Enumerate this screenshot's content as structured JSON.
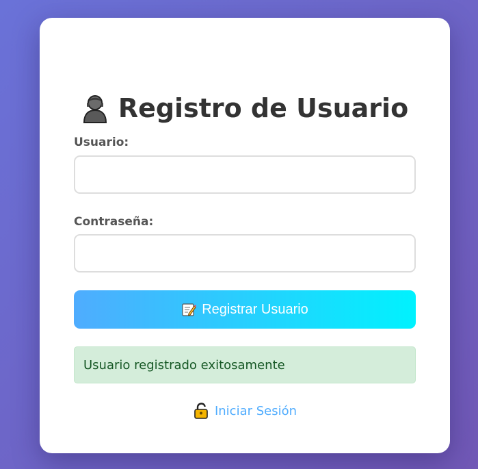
{
  "form": {
    "title": "Registro de Usuario",
    "title_icon": "user-silhouette-icon",
    "username_label": "Usuario:",
    "username_value": "",
    "password_label": "Contraseña:",
    "password_value": "",
    "submit_label": "Registrar Usuario",
    "submit_icon": "memo-icon",
    "success_message": "Usuario registrado exitosamente",
    "login_link_label": "Iniciar Sesión",
    "login_link_icon": "lock-icon"
  },
  "colors": {
    "background_start": "#6a72d8",
    "background_end": "#7158b6",
    "card": "#ffffff",
    "button_start": "#4facfe",
    "button_end": "#00f2fe",
    "success_bg": "#d4edda",
    "success_text": "#155724",
    "link": "#4facfe"
  }
}
